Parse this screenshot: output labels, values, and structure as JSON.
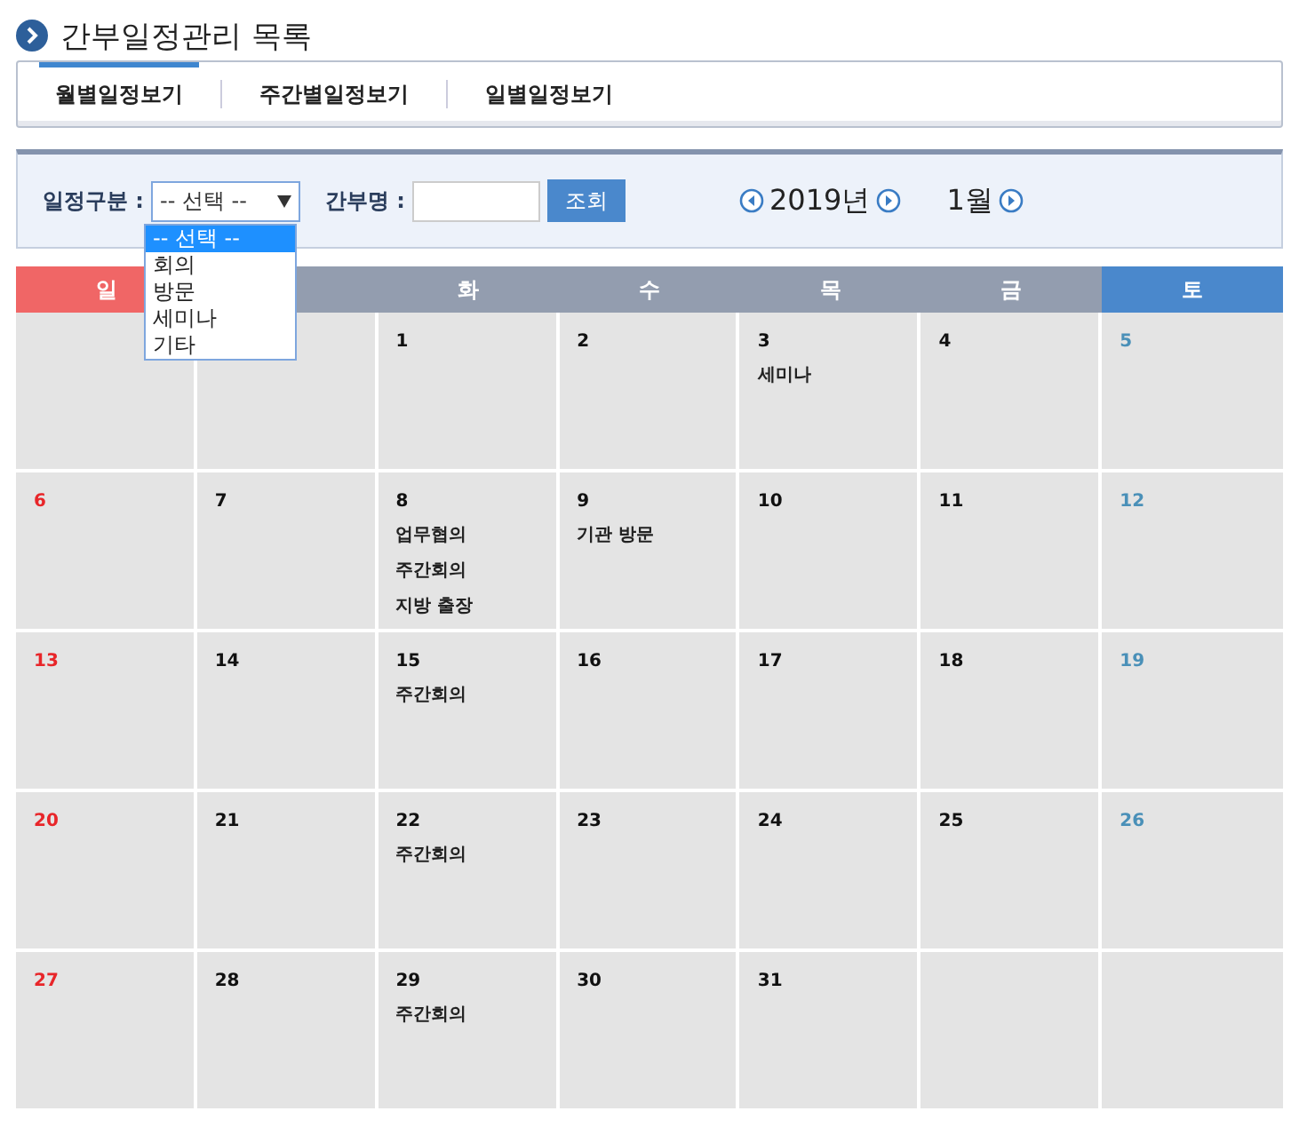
{
  "page_title": "간부일정관리 목록",
  "tabs": [
    {
      "label": "월별일정보기",
      "selected": true
    },
    {
      "label": "주간별일정보기",
      "selected": false
    },
    {
      "label": "일별일정보기",
      "selected": false
    }
  ],
  "filter": {
    "type_label": "일정구분 :",
    "type_value": "-- 선택 --",
    "type_options": [
      {
        "label": "-- 선택 --",
        "selected": true
      },
      {
        "label": "회의",
        "selected": false
      },
      {
        "label": "방문",
        "selected": false
      },
      {
        "label": "세미나",
        "selected": false
      },
      {
        "label": "기타",
        "selected": false
      }
    ],
    "name_label": "간부명 :",
    "search_button": "조회",
    "year": "2019년",
    "month": "1월"
  },
  "calendar": {
    "headers": [
      {
        "label": "일",
        "kind": "sunday"
      },
      {
        "kind": "weekday"
      },
      {
        "label": "화",
        "kind": "weekday"
      },
      {
        "label": "수",
        "kind": "weekday"
      },
      {
        "label": "목",
        "kind": "weekday"
      },
      {
        "label": "금",
        "kind": "weekday"
      },
      {
        "label": "토",
        "kind": "saturday"
      }
    ],
    "weeks": [
      [
        {
          "kind": "blank"
        },
        {
          "kind": "blank"
        },
        {
          "day": "1"
        },
        {
          "day": "2"
        },
        {
          "day": "3",
          "events": [
            "세미나"
          ]
        },
        {
          "day": "4"
        },
        {
          "day": "5"
        }
      ],
      [
        {
          "day": "6"
        },
        {
          "day": "7"
        },
        {
          "day": "8",
          "events": [
            "업무협의",
            "주간회의",
            "지방 출장"
          ]
        },
        {
          "day": "9",
          "events": [
            "기관 방문"
          ]
        },
        {
          "day": "10"
        },
        {
          "day": "11"
        },
        {
          "day": "12"
        }
      ],
      [
        {
          "day": "13"
        },
        {
          "day": "14"
        },
        {
          "day": "15",
          "events": [
            "주간회의"
          ]
        },
        {
          "day": "16"
        },
        {
          "day": "17"
        },
        {
          "day": "18"
        },
        {
          "day": "19"
        }
      ],
      [
        {
          "day": "20"
        },
        {
          "day": "21"
        },
        {
          "day": "22",
          "events": [
            "주간회의"
          ]
        },
        {
          "day": "23"
        },
        {
          "day": "24"
        },
        {
          "day": "25"
        },
        {
          "day": "26"
        }
      ],
      [
        {
          "day": "27"
        },
        {
          "day": "28"
        },
        {
          "day": "29",
          "events": [
            "주간회의"
          ]
        },
        {
          "day": "30"
        },
        {
          "day": "31"
        },
        {
          "kind": "blank"
        },
        {
          "kind": "blank"
        }
      ]
    ]
  }
}
